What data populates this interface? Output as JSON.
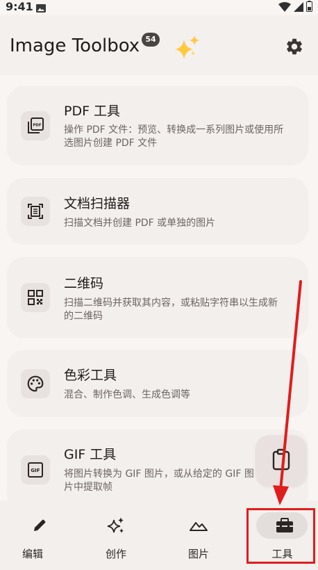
{
  "status_bar": {
    "time": "9:41"
  },
  "app_bar": {
    "title": "Image Toolbox",
    "badge": "54"
  },
  "tools": [
    {
      "title": "PDF 工具",
      "description": "操作 PDF 文件：预览、转换成一系列图片或使用所选图片创建 PDF 文件",
      "icon": "pdf-icon"
    },
    {
      "title": "文档扫描器",
      "description": "扫描文档并创建 PDF 或单独的图片",
      "icon": "document-scanner-icon"
    },
    {
      "title": "二维码",
      "description": "扫描二维码并获取其内容，或粘贴字符串以生成新的二维码",
      "icon": "qr-code-icon"
    },
    {
      "title": "色彩工具",
      "description": "混合、制作色调、生成色调等",
      "icon": "palette-icon"
    },
    {
      "title": "GIF 工具",
      "description": "将图片转换为 GIF 图片，或从给定的 GIF 图片中提取帧",
      "icon": "gif-icon"
    }
  ],
  "fab": {
    "icon": "clipboard-icon"
  },
  "bottom_nav": [
    {
      "label": "编辑",
      "icon": "pencil-icon",
      "selected": false
    },
    {
      "label": "创作",
      "icon": "sparkles-icon",
      "selected": false
    },
    {
      "label": "图片",
      "icon": "mountain-icon",
      "selected": false
    },
    {
      "label": "工具",
      "icon": "toolbox-icon",
      "selected": true
    }
  ],
  "colors": {
    "background": "#f8f5f3",
    "card": "#f3efed",
    "badge": "#4a4543",
    "annotation_red": "#e01c1c"
  }
}
